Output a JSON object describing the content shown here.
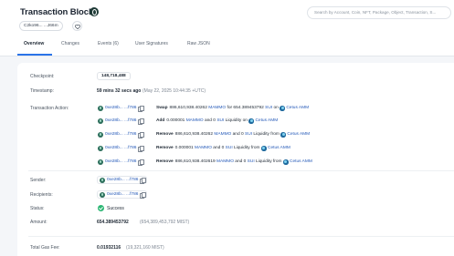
{
  "header": {
    "title": "Transaction Block",
    "digest": "C2ko96... ...J66m",
    "search_placeholder": "Search by Account, Coin, NFT, Package, Object, Transaction, S..."
  },
  "tabs": [
    {
      "label": "Overview",
      "active": true
    },
    {
      "label": "Changes",
      "active": false
    },
    {
      "label": "Events (6)",
      "active": false
    },
    {
      "label": "User Signatures",
      "active": false
    },
    {
      "label": "Raw JSON",
      "active": false
    }
  ],
  "details": {
    "checkpoint_label": "Checkpoint:",
    "checkpoint_value": "148,718,488",
    "timestamp_label": "Timestamp:",
    "timestamp_value": "59 mins 32 secs ago",
    "timestamp_detail": "(May 22, 2025 10:44:35 +UTC)",
    "action_label": "Transaction Action:",
    "actions": [
      {
        "address": "0xe28b... ...f786",
        "verb": "Swap",
        "text_before": "886,610,938.40262",
        "token_a": "MAMMO",
        "mid": "for 654.389453792",
        "token_b": "SUI",
        "tail": "on",
        "protocol": "Cetus AMM"
      },
      {
        "address": "0xe28b... ...f786",
        "verb": "Add",
        "text_before": "0.000001",
        "token_a": "MAMMO",
        "mid": "and 0",
        "token_b": "SUI",
        "tail": "Liquidity on",
        "protocol": "Cetus AMM"
      },
      {
        "address": "0xe28b... ...f786",
        "verb": "Remove",
        "text_before": "886,610,938.40262",
        "token_a": "MAMMO",
        "mid": "and 0",
        "token_b": "SUI",
        "tail": "Liquidity from",
        "protocol": "Cetus AMM"
      },
      {
        "address": "0xe28b... ...f786",
        "verb": "Remove",
        "text_before": "0.000001",
        "token_a": "MAMMO",
        "mid": "and 0",
        "token_b": "SUI",
        "tail": "Liquidity from",
        "protocol": "Cetus AMM"
      },
      {
        "address": "0xe28b... ...f786",
        "verb": "Remove",
        "text_before": "886,610,938.402619",
        "token_a": "MAMMO",
        "mid": "and 0",
        "token_b": "SUI",
        "tail": "Liquidity from",
        "protocol": "Cetus AMM"
      }
    ],
    "sender_label": "Sender:",
    "sender_value": "0xe28b... ...f786",
    "recipients_label": "Recipients:",
    "recipients_value": "0xe28b... ...f786",
    "status_label": "Status:",
    "status_value": "Success",
    "amount_label": "Amount:",
    "amount_value": "654.389453792",
    "amount_detail": "(654,389,453,792 MIST)",
    "gas_label": "Total Gas Fee:",
    "gas_value": "0.01932116",
    "gas_detail": "(19,321,160 MIST)"
  },
  "colors": {
    "accent": "#2a73e8",
    "link": "#2459b8",
    "success": "#2bb673"
  }
}
